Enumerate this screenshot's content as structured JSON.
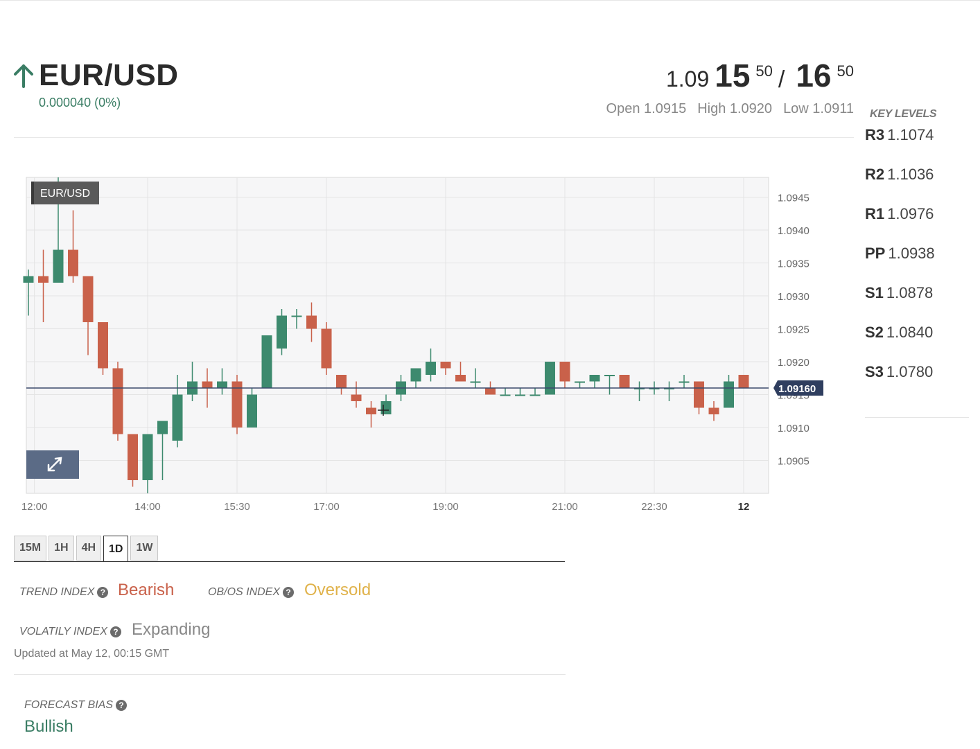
{
  "header": {
    "pair": "EUR/USD",
    "change": "0.000040 (0%)",
    "bid": {
      "prefix": "1.09",
      "pips": "15",
      "fraction": "50"
    },
    "ask": {
      "pips": "16",
      "fraction": "50"
    },
    "separator": "/",
    "open": "Open 1.0915",
    "high": "High 1.0920",
    "low": "Low 1.0911"
  },
  "key_levels": {
    "title": "KEY LEVELS",
    "levels": [
      {
        "name": "R3",
        "value": "1.1074"
      },
      {
        "name": "R2",
        "value": "1.1036"
      },
      {
        "name": "R1",
        "value": "1.0976"
      },
      {
        "name": "PP",
        "value": "1.0938"
      },
      {
        "name": "S1",
        "value": "1.0878"
      },
      {
        "name": "S2",
        "value": "1.0840"
      },
      {
        "name": "S3",
        "value": "1.0780"
      }
    ]
  },
  "chart_data": {
    "type": "candlestick",
    "title": "EUR/USD",
    "ylim": [
      1.09,
      1.0948
    ],
    "yticks": [
      1.0905,
      1.091,
      1.0915,
      1.092,
      1.0925,
      1.093,
      1.0935,
      1.094,
      1.0945
    ],
    "ytick_labels": [
      "1.0905",
      "1.0910",
      "1.0915",
      "1.0920",
      "1.0925",
      "1.0930",
      "1.0935",
      "1.0940",
      "1.0945"
    ],
    "xticks": [
      {
        "label": "12:00",
        "index": 0.4
      },
      {
        "label": "14:00",
        "index": 8.0
      },
      {
        "label": "15:30",
        "index": 14.0
      },
      {
        "label": "17:00",
        "index": 20.0
      },
      {
        "label": "19:00",
        "index": 28.0
      },
      {
        "label": "21:00",
        "index": 36.0
      },
      {
        "label": "22:30",
        "index": 42.0
      },
      {
        "label": "12",
        "index": 48.0,
        "bold": true
      }
    ],
    "last_price": 1.0916,
    "last_price_label": "1.09160",
    "up_color": "#3d8a6e",
    "down_color": "#c9614a",
    "candles": [
      {
        "o": 1.0932,
        "h": 1.0934,
        "l": 1.0927,
        "c": 1.0933
      },
      {
        "o": 1.0933,
        "h": 1.0937,
        "l": 1.0926,
        "c": 1.0932
      },
      {
        "o": 1.0932,
        "h": 1.0948,
        "l": 1.0932,
        "c": 1.0937
      },
      {
        "o": 1.0937,
        "h": 1.0943,
        "l": 1.0932,
        "c": 1.0933
      },
      {
        "o": 1.0933,
        "h": 1.0933,
        "l": 1.0921,
        "c": 1.0926
      },
      {
        "o": 1.0926,
        "h": 1.0926,
        "l": 1.0918,
        "c": 1.0919
      },
      {
        "o": 1.0919,
        "h": 1.092,
        "l": 1.0908,
        "c": 1.0909
      },
      {
        "o": 1.0909,
        "h": 1.0909,
        "l": 1.0901,
        "c": 1.0902
      },
      {
        "o": 1.0902,
        "h": 1.0909,
        "l": 1.09,
        "c": 1.0909
      },
      {
        "o": 1.0909,
        "h": 1.0911,
        "l": 1.0902,
        "c": 1.0911
      },
      {
        "o": 1.0908,
        "h": 1.0918,
        "l": 1.0907,
        "c": 1.0915
      },
      {
        "o": 1.0915,
        "h": 1.092,
        "l": 1.0914,
        "c": 1.0917
      },
      {
        "o": 1.0917,
        "h": 1.0919,
        "l": 1.0913,
        "c": 1.0916
      },
      {
        "o": 1.0916,
        "h": 1.0919,
        "l": 1.0915,
        "c": 1.0917
      },
      {
        "o": 1.0917,
        "h": 1.0918,
        "l": 1.0909,
        "c": 1.091
      },
      {
        "o": 1.091,
        "h": 1.0916,
        "l": 1.091,
        "c": 1.0915
      },
      {
        "o": 1.0916,
        "h": 1.0924,
        "l": 1.0916,
        "c": 1.0924
      },
      {
        "o": 1.0922,
        "h": 1.0928,
        "l": 1.0921,
        "c": 1.0927
      },
      {
        "o": 1.0927,
        "h": 1.0928,
        "l": 1.0925,
        "c": 1.0927
      },
      {
        "o": 1.0927,
        "h": 1.0929,
        "l": 1.0923,
        "c": 1.0925
      },
      {
        "o": 1.0925,
        "h": 1.0926,
        "l": 1.0918,
        "c": 1.0919
      },
      {
        "o": 1.0918,
        "h": 1.0918,
        "l": 1.0915,
        "c": 1.0916
      },
      {
        "o": 1.0915,
        "h": 1.0917,
        "l": 1.0913,
        "c": 1.0914
      },
      {
        "o": 1.0913,
        "h": 1.0914,
        "l": 1.091,
        "c": 1.0912
      },
      {
        "o": 1.0912,
        "h": 1.0915,
        "l": 1.0912,
        "c": 1.0914
      },
      {
        "o": 1.0915,
        "h": 1.0918,
        "l": 1.0914,
        "c": 1.0917
      },
      {
        "o": 1.0917,
        "h": 1.0919,
        "l": 1.0916,
        "c": 1.0919
      },
      {
        "o": 1.0918,
        "h": 1.0922,
        "l": 1.0917,
        "c": 1.092
      },
      {
        "o": 1.092,
        "h": 1.092,
        "l": 1.0918,
        "c": 1.0919
      },
      {
        "o": 1.0918,
        "h": 1.092,
        "l": 1.0917,
        "c": 1.0917
      },
      {
        "o": 1.0917,
        "h": 1.0919,
        "l": 1.0916,
        "c": 1.0917
      },
      {
        "o": 1.0916,
        "h": 1.0917,
        "l": 1.0915,
        "c": 1.0915
      },
      {
        "o": 1.0915,
        "h": 1.0916,
        "l": 1.0915,
        "c": 1.0915
      },
      {
        "o": 1.0915,
        "h": 1.0916,
        "l": 1.0915,
        "c": 1.0915
      },
      {
        "o": 1.0915,
        "h": 1.0916,
        "l": 1.0915,
        "c": 1.0915
      },
      {
        "o": 1.0915,
        "h": 1.092,
        "l": 1.0915,
        "c": 1.092
      },
      {
        "o": 1.092,
        "h": 1.092,
        "l": 1.0916,
        "c": 1.0917
      },
      {
        "o": 1.0917,
        "h": 1.0917,
        "l": 1.0916,
        "c": 1.0917
      },
      {
        "o": 1.0917,
        "h": 1.0918,
        "l": 1.0916,
        "c": 1.0918
      },
      {
        "o": 1.0918,
        "h": 1.0918,
        "l": 1.0915,
        "c": 1.0918
      },
      {
        "o": 1.0918,
        "h": 1.0918,
        "l": 1.0916,
        "c": 1.0916
      },
      {
        "o": 1.0916,
        "h": 1.0917,
        "l": 1.0914,
        "c": 1.0916
      },
      {
        "o": 1.0916,
        "h": 1.0917,
        "l": 1.0915,
        "c": 1.0916
      },
      {
        "o": 1.0916,
        "h": 1.0917,
        "l": 1.0914,
        "c": 1.0916
      },
      {
        "o": 1.0917,
        "h": 1.0918,
        "l": 1.0916,
        "c": 1.0917
      },
      {
        "o": 1.0917,
        "h": 1.0917,
        "l": 1.0912,
        "c": 1.0913
      },
      {
        "o": 1.0913,
        "h": 1.0914,
        "l": 1.0911,
        "c": 1.0912
      },
      {
        "o": 1.0913,
        "h": 1.0918,
        "l": 1.0913,
        "c": 1.0917
      },
      {
        "o": 1.0918,
        "h": 1.0918,
        "l": 1.0916,
        "c": 1.0916
      }
    ]
  },
  "timeframes": {
    "items": [
      "15M",
      "1H",
      "4H",
      "1D",
      "1W"
    ],
    "active": "1D"
  },
  "indices": {
    "trend_label": "TREND INDEX",
    "trend_value": "Bearish",
    "trend_color": "#c9614a",
    "obos_label": "OB/OS INDEX",
    "obos_value": "Oversold",
    "obos_color": "#e0b24a",
    "volatility_label": "VOLATILY INDEX",
    "volatility_value": "Expanding",
    "volatility_color": "#888888",
    "updated": "Updated at May 12, 00:15 GMT",
    "forecast_label": "FORECAST BIAS",
    "forecast_value": "Bullish",
    "forecast_color": "#3a7d64"
  },
  "icons": {
    "help": "?",
    "trend_arrow": "arrow-up-icon",
    "expand": "expand-icon"
  }
}
